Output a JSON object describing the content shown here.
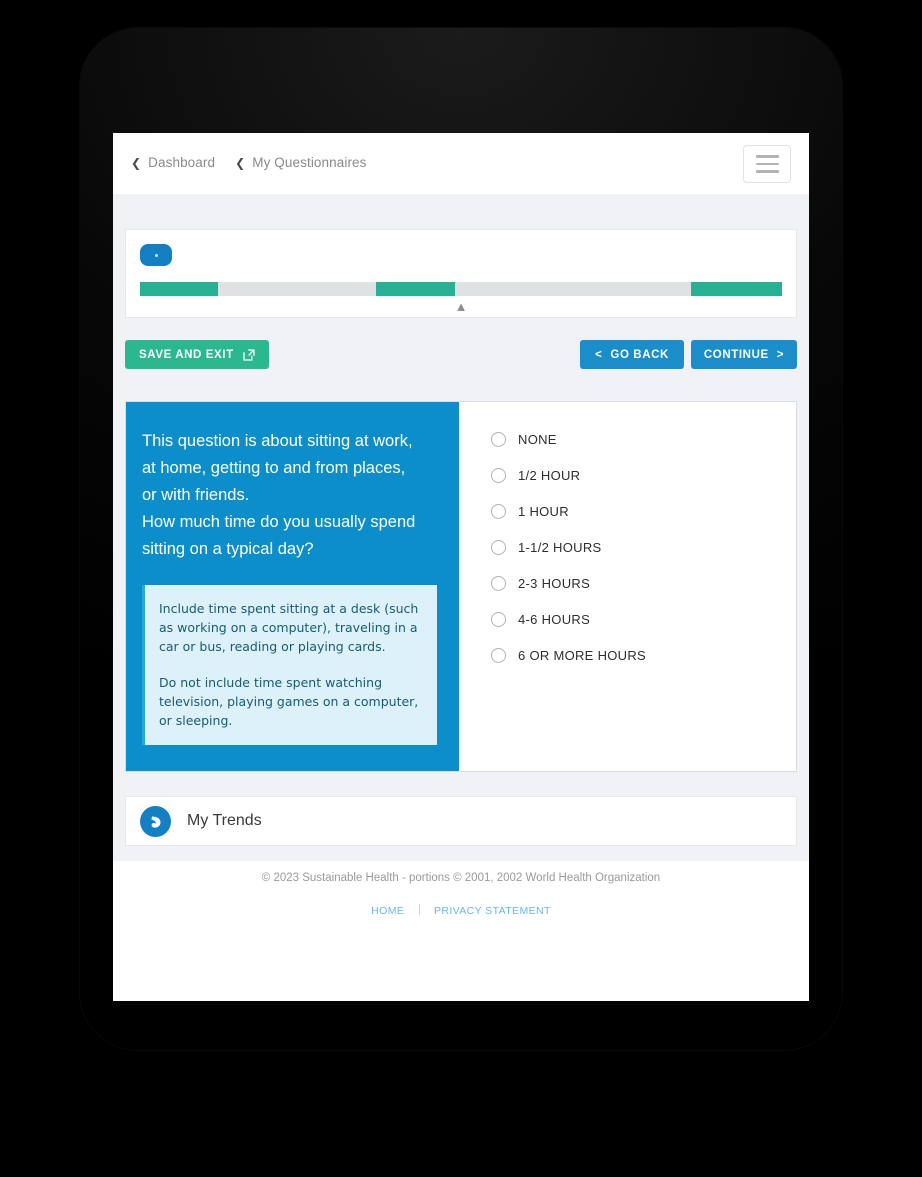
{
  "header": {
    "breadcrumbs": [
      {
        "label": "Dashboard",
        "icon": "chevron-left-icon"
      },
      {
        "label": "My Questionnaires",
        "icon": "chevron-left-icon"
      }
    ],
    "menu_icon": "hamburger-icon"
  },
  "progress": {
    "badge_label": "",
    "collapse_icon": "chevron-up-icon",
    "segments": [
      {
        "start_pct": 0,
        "width_pct": 12.2,
        "filled": true
      },
      {
        "start_pct": 12.2,
        "width_pct": 24.6,
        "filled": false
      },
      {
        "start_pct": 36.8,
        "width_pct": 12.2,
        "filled": true
      },
      {
        "start_pct": 49.0,
        "width_pct": 36.8,
        "filled": false
      },
      {
        "start_pct": 85.8,
        "width_pct": 14.2,
        "filled": true
      }
    ],
    "track_color": "#e0e1e2",
    "fill_color": "#26b193"
  },
  "actions": {
    "save_label": "SAVE AND EXIT",
    "save_icon": "external-link-icon",
    "back_label": "GO BACK",
    "back_icon": "less-than-icon",
    "continue_label": "CONTINUE",
    "continue_icon": "greater-than-icon",
    "save_color": "#2ab98f",
    "nav_color": "#1a8ecb"
  },
  "question": {
    "lines": [
      "This question is about sitting at work,",
      "at home, getting to and from places,",
      "or with friends.",
      "How much time do you usually spend",
      "sitting on a typical day?"
    ],
    "info_paragraphs": [
      "Include time spent sitting at a desk (such as working on a computer), traveling in a car or bus, reading or playing cards.",
      "Do not include time spent watching television, playing games on a computer, or sleeping."
    ],
    "panel_color": "#0b8ec9",
    "info_bg": "#ddf1fb",
    "info_text_color": "#185c6e",
    "options": [
      {
        "label": "NONE",
        "selected": false
      },
      {
        "label": "1/2 HOUR",
        "selected": false
      },
      {
        "label": "1 HOUR",
        "selected": false
      },
      {
        "label": "1-1/2 HOURS",
        "selected": false
      },
      {
        "label": "2-3 HOURS",
        "selected": false
      },
      {
        "label": "4-6 HOURS",
        "selected": false
      },
      {
        "label": "6 OR MORE HOURS",
        "selected": false
      }
    ]
  },
  "trends": {
    "label": "My Trends",
    "icon": "trend-swoosh-icon",
    "icon_color": "#1380c4"
  },
  "footer": {
    "copyright": "© 2023 Sustainable Health  -  portions © 2001, 2002 World Health Organization",
    "links": [
      {
        "label": "HOME"
      },
      {
        "label": "PRIVACY STATEMENT"
      }
    ],
    "link_color": "#69b7e8"
  }
}
